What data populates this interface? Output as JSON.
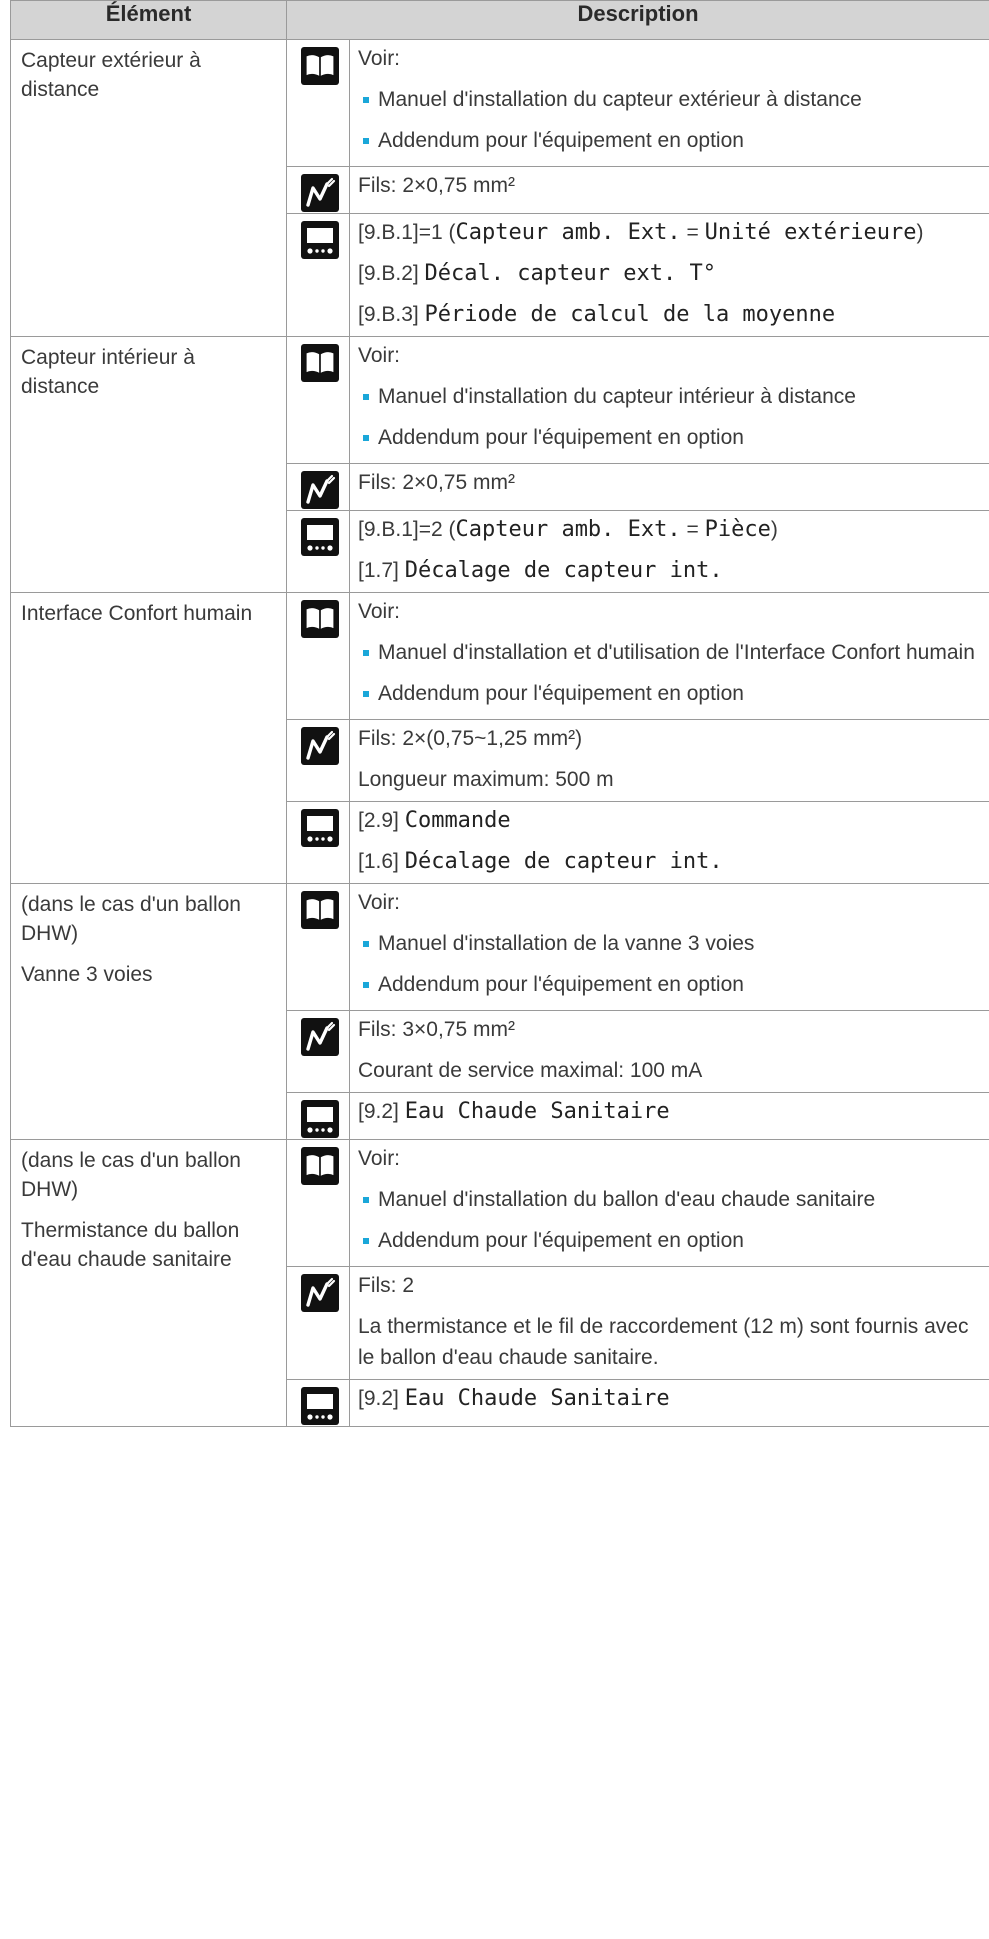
{
  "headers": {
    "element": "Élément",
    "description": "Description"
  },
  "icon_names": {
    "manual": "book-icon",
    "wire": "wiring-icon",
    "ui": "user-interface-icon"
  },
  "sections": [
    {
      "element": [
        "Capteur extérieur à distance"
      ],
      "manual": {
        "intro": "Voir:",
        "bullets": [
          "Manuel d'installation du capteur extérieur à distance",
          "Addendum pour l'équipement en option"
        ]
      },
      "wire": [
        "Fils: 2×0,75 mm²"
      ],
      "ui": [
        [
          {
            "t": "[9.B.1]=1 (",
            "m": false
          },
          {
            "t": "Capteur amb. Ext.",
            "m": true
          },
          {
            "t": " = ",
            "m": false
          },
          {
            "t": "Unité extérieure",
            "m": true
          },
          {
            "t": ")",
            "m": false
          }
        ],
        [
          {
            "t": "[9.B.2] ",
            "m": false
          },
          {
            "t": "Décal. capteur ext. T°",
            "m": true
          }
        ],
        [
          {
            "t": "[9.B.3] ",
            "m": false
          },
          {
            "t": "Période de calcul de la moyenne",
            "m": true
          }
        ]
      ]
    },
    {
      "element": [
        "Capteur intérieur à distance"
      ],
      "manual": {
        "intro": "Voir:",
        "bullets": [
          "Manuel d'installation du capteur intérieur à distance",
          "Addendum pour l'équipement en option"
        ]
      },
      "wire": [
        "Fils: 2×0,75 mm²"
      ],
      "ui": [
        [
          {
            "t": "[9.B.1]=2 (",
            "m": false
          },
          {
            "t": "Capteur amb. Ext.",
            "m": true
          },
          {
            "t": " = ",
            "m": false
          },
          {
            "t": "Pièce",
            "m": true
          },
          {
            "t": ")",
            "m": false
          }
        ],
        [
          {
            "t": "[1.7] ",
            "m": false
          },
          {
            "t": "Décalage de capteur int.",
            "m": true
          }
        ]
      ]
    },
    {
      "element": [
        "Interface Confort humain"
      ],
      "manual": {
        "intro": "Voir:",
        "bullets": [
          "Manuel d'installation et d'utilisation de l'Interface Confort humain",
          "Addendum pour l'équipement en option"
        ]
      },
      "wire": [
        "Fils: 2×(0,75~1,25 mm²)",
        "Longueur maximum: 500 m"
      ],
      "ui": [
        [
          {
            "t": "[2.9] ",
            "m": false
          },
          {
            "t": "Commande",
            "m": true
          }
        ],
        [
          {
            "t": "[1.6] ",
            "m": false
          },
          {
            "t": "Décalage de capteur int.",
            "m": true
          }
        ]
      ]
    },
    {
      "element": [
        "(dans le cas d'un ballon DHW)",
        "Vanne 3 voies"
      ],
      "manual": {
        "intro": "Voir:",
        "bullets": [
          "Manuel d'installation de la vanne 3 voies",
          "Addendum pour l'équipement en option"
        ]
      },
      "wire": [
        "Fils: 3×0,75 mm²",
        "Courant de service maximal: 100 mA"
      ],
      "ui": [
        [
          {
            "t": "[9.2] ",
            "m": false
          },
          {
            "t": "Eau Chaude Sanitaire",
            "m": true
          }
        ]
      ]
    },
    {
      "element": [
        "(dans le cas d'un ballon DHW)",
        "Thermistance du ballon d'eau chaude sanitaire"
      ],
      "manual": {
        "intro": "Voir:",
        "bullets": [
          "Manuel d'installation du ballon d'eau chaude sanitaire",
          "Addendum pour l'équipement en option"
        ]
      },
      "wire": [
        "Fils: 2",
        "La thermistance et le fil de raccordement (12 m) sont fournis avec le ballon d'eau chaude sanitaire."
      ],
      "ui": [
        [
          {
            "t": "[9.2] ",
            "m": false
          },
          {
            "t": "Eau Chaude Sanitaire",
            "m": true
          }
        ]
      ]
    }
  ]
}
